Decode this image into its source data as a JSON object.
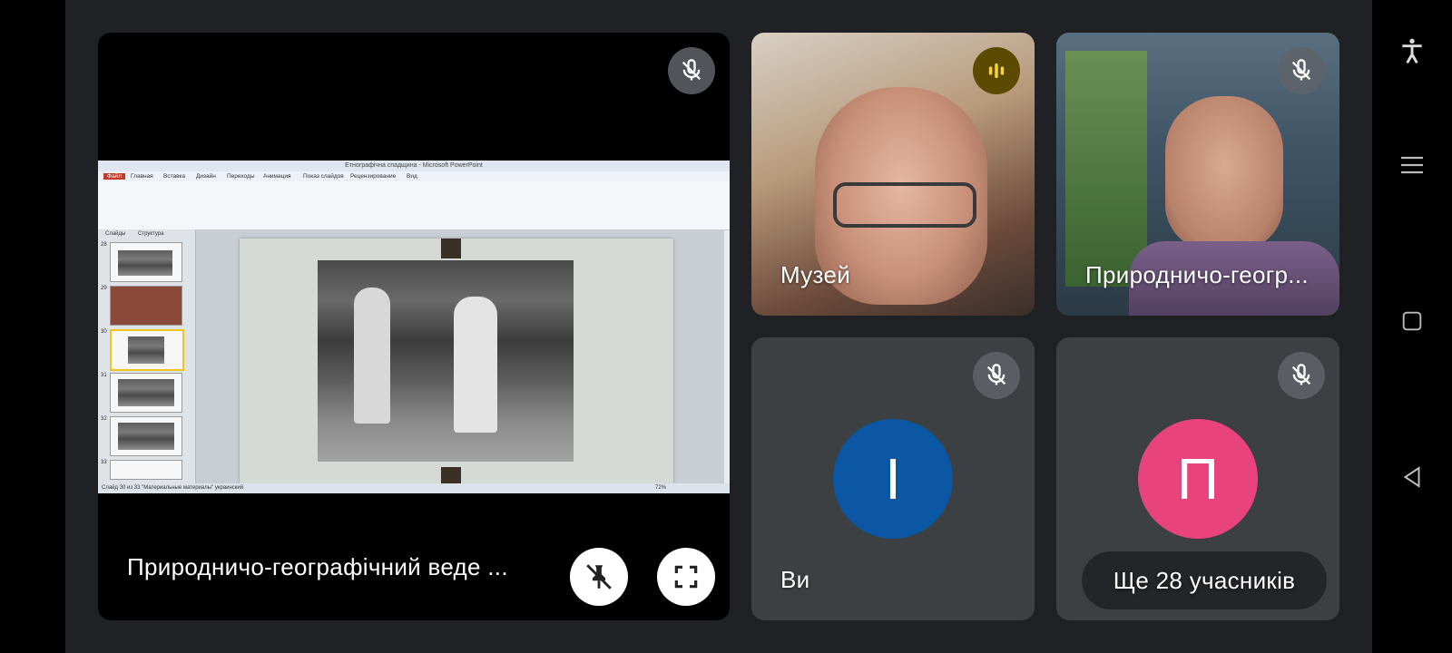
{
  "tiles": {
    "presenter": {
      "name": "Природничо-географічний веде ...",
      "mic_icon": "mic-off-icon",
      "unpin_icon": "unpin-icon",
      "fullscreen_icon": "fullscreen-icon"
    },
    "museum": {
      "name": "Музей",
      "speaking_icon": "audio-level-icon"
    },
    "geo": {
      "name": "Природничо-геогр...",
      "mic_icon": "mic-off-icon"
    },
    "you": {
      "name": "Ви",
      "initial": "І",
      "avatar_color": "#0b57a4",
      "mic_icon": "mic-off-icon"
    },
    "others": {
      "more_label": "Ще 28 учасників",
      "initial": "П",
      "avatar_color": "#e8437a",
      "mic_icon": "mic-off-icon"
    }
  },
  "presentation": {
    "window_title": "Етнографічна спадщина - Microsoft PowerPoint",
    "menu": [
      "Файл",
      "Главная",
      "Вставка",
      "Дизайн",
      "Переходы",
      "Анимация",
      "Показ слайдов",
      "Рецензирование",
      "Вид"
    ],
    "panel_tabs": [
      "Слайды",
      "Структура"
    ],
    "slide_numbers": [
      "28",
      "29",
      "30",
      "31",
      "32",
      "33"
    ],
    "status_text": "Слайд 30 из 33   \"Материальные материалы\"   украинский",
    "zoom": "72%"
  },
  "system_nav": [
    "accessibility-icon",
    "menu-icon",
    "recents-icon",
    "back-icon"
  ],
  "colors": {
    "stage_bg": "#202124",
    "tile_bg": "#3c4043",
    "speaking": "#5b4a00"
  }
}
